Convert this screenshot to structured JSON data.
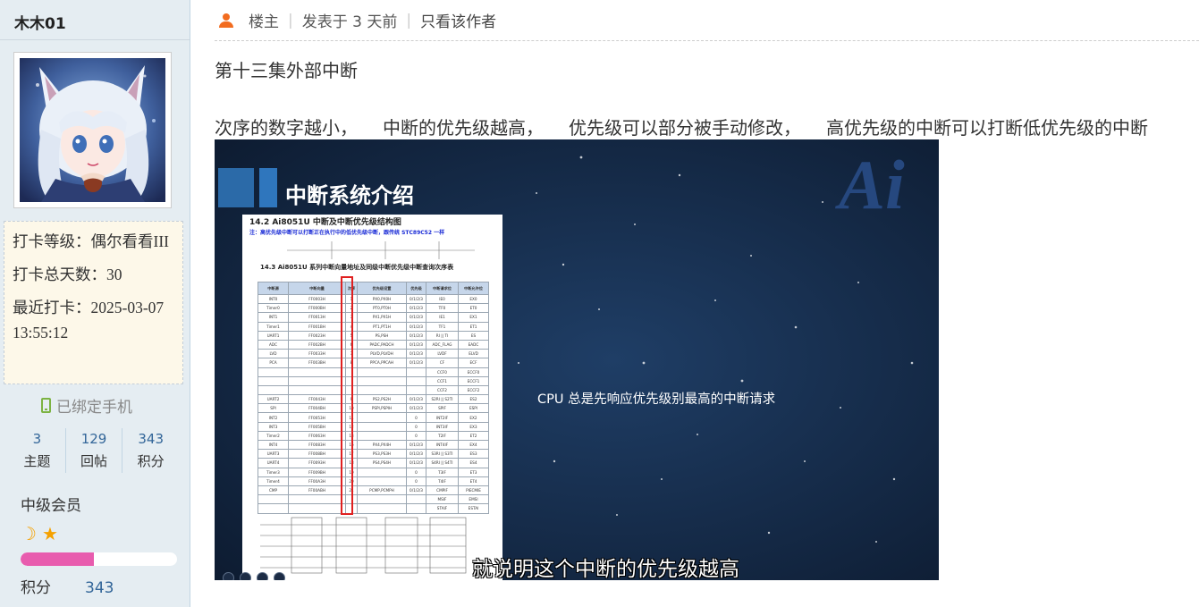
{
  "user": {
    "name": "木木01",
    "checkin": {
      "level": "打卡等级：偶尔看看III",
      "total_days": "打卡总天数：30",
      "last": "最近打卡：2025-03-07 13:55:12"
    },
    "phone_bound": "已绑定手机",
    "stats": [
      {
        "value": "3",
        "label": "主题"
      },
      {
        "value": "129",
        "label": "回帖"
      },
      {
        "value": "343",
        "label": "积分"
      }
    ],
    "group": "中级会员",
    "medals": [
      "moon-icon",
      "star-icon"
    ],
    "points_progress": 0.47,
    "points_label": "积分",
    "points_value": "343",
    "colors": {
      "progress": "#e85cae",
      "link": "#336699",
      "accent": "#f26c1f"
    }
  },
  "post": {
    "author_role": "楼主",
    "posted_time": "发表于 3 天前",
    "only_author": "只看该作者",
    "title": "第十三集外部中断",
    "text_parts": [
      "次序的数字越小，",
      "中断的优先级越高，",
      "优先级可以部分被手动修改，",
      "高优先级的中断可以打断低优先级的中断"
    ]
  },
  "video": {
    "slide_title": "中断系统介绍",
    "logo_text": "Ai",
    "doc_heading": "14.2    Ai8051U 中断及中断优先级结构图",
    "doc_note": "注：高优先级中断可以打断正在执行中的低优先级中断，跟传统 STC89C52 一样",
    "doc_subheading": "14.3    Ai8051U 系列中断向量地址及同级中断优先级中断查询次序表",
    "table_headers": [
      "中断源",
      "中断向量",
      "次序",
      "优先级设置",
      "优先级",
      "中断请求位",
      "中断允许位"
    ],
    "table_rows": [
      [
        "INT0",
        "FF0003H",
        "1",
        "PX0,PX0H",
        "0/1/2/3",
        "IE0",
        "EX0"
      ],
      [
        "Timer0",
        "FF000BH",
        "2",
        "PT0,PT0H",
        "0/1/2/3",
        "TF0",
        "ET0"
      ],
      [
        "INT1",
        "FF0013H",
        "3",
        "PX1,PX1H",
        "0/1/2/3",
        "IE1",
        "EX1"
      ],
      [
        "Timer1",
        "FF001BH",
        "4",
        "PT1,PT1H",
        "0/1/2/3",
        "TF1",
        "ET1"
      ],
      [
        "UART1",
        "FF0023H",
        "5",
        "PS,PSH",
        "0/1/2/3",
        "RI || TI",
        "ES"
      ],
      [
        "ADC",
        "FF002BH",
        "6",
        "PADC,PADCH",
        "0/1/2/3",
        "ADC_FLAG",
        "EADC"
      ],
      [
        "LVD",
        "FF0033H",
        "7",
        "PLVD,PLVDH",
        "0/1/2/3",
        "LVDF",
        "ELVD"
      ],
      [
        "PCA",
        "FF003BH",
        "8",
        "PPCA,PPCAH",
        "0/1/2/3",
        "CF",
        "ECF"
      ],
      [
        "",
        "",
        "",
        "",
        "",
        "CCF0",
        "ECCF0"
      ],
      [
        "",
        "",
        "",
        "",
        "",
        "CCF1",
        "ECCF1"
      ],
      [
        "",
        "",
        "",
        "",
        "",
        "CCF2",
        "ECCF2"
      ],
      [
        "UART2",
        "FF0043H",
        "9",
        "PS2,PS2H",
        "0/1/2/3",
        "S2RI || S2TI",
        "ES2"
      ],
      [
        "SPI",
        "FF004BH",
        "10",
        "PSPI,PSPIH",
        "0/1/2/3",
        "SPIF",
        "ESPI"
      ],
      [
        "INT2",
        "FF0053H",
        "11",
        "",
        "0",
        "INT2IF",
        "EX2"
      ],
      [
        "INT3",
        "FF005BH",
        "12",
        "",
        "0",
        "INT3IF",
        "EX3"
      ],
      [
        "Timer2",
        "FF0063H",
        "13",
        "",
        "0",
        "T2IF",
        "ET2"
      ],
      [
        "INT4",
        "FF0083H",
        "16",
        "PX4,PX4H",
        "0/1/2/3",
        "INT4IF",
        "EX4"
      ],
      [
        "UART3",
        "FF008BH",
        "17",
        "PS3,PS3H",
        "0/1/2/3",
        "S3RI || S3TI",
        "ES3"
      ],
      [
        "UART4",
        "FF0093H",
        "18",
        "PS4,PS4H",
        "0/1/2/3",
        "S4RI || S4TI",
        "ES4"
      ],
      [
        "Timer3",
        "FF009BH",
        "19",
        "",
        "0",
        "T3IF",
        "ET3"
      ],
      [
        "Timer4",
        "FF00A3H",
        "20",
        "",
        "0",
        "T4IF",
        "ET4"
      ],
      [
        "CMP",
        "FF00ABH",
        "21",
        "PCMP,PCMPH",
        "0/1/2/3",
        "CMPIF",
        "PIECMIE"
      ],
      [
        "",
        "",
        "",
        "",
        "",
        "MSIF",
        "EMSI"
      ],
      [
        "",
        "",
        "",
        "",
        "",
        "STAIF",
        "ESTAI"
      ]
    ],
    "cpu_caption": "CPU 总是先响应优先级别最高的中断请求",
    "subtitle": "就说明这个中断的优先级越高"
  }
}
